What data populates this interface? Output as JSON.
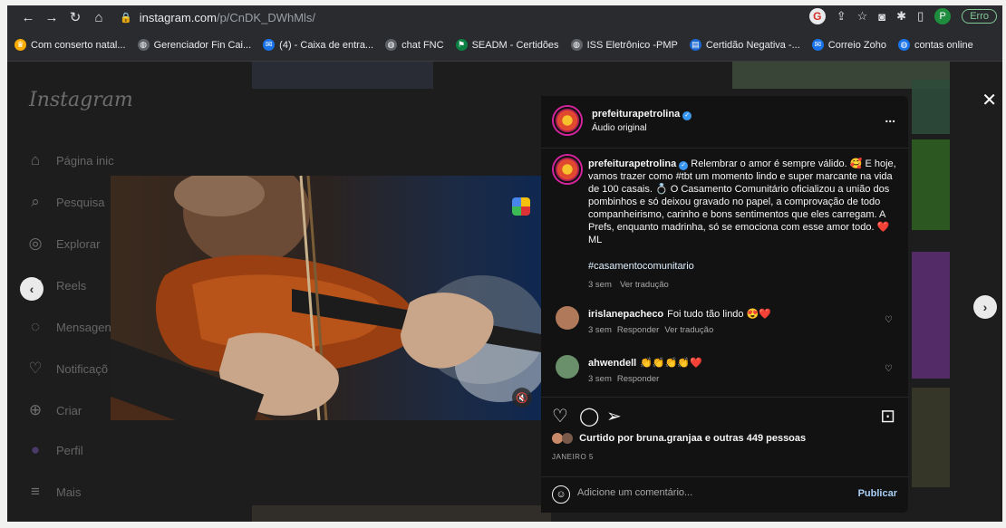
{
  "browser": {
    "url_host": "instagram.com",
    "url_path": "/p/CnDK_DWhMls/",
    "error_button": "Erro",
    "profile_initial": "P"
  },
  "bookmarks": [
    {
      "label": "Com conserto natal...",
      "icon": "crown-icon",
      "color": "#f9ab00"
    },
    {
      "label": "Gerenciador Fin Cai...",
      "icon": "globe-icon",
      "color": "#5f6368"
    },
    {
      "label": "(4) - Caixa de entra...",
      "icon": "mail-icon",
      "color": "#1a73e8"
    },
    {
      "label": "chat FNC",
      "icon": "globe-icon",
      "color": "#5f6368"
    },
    {
      "label": "SEADM - Certidões",
      "icon": "flag-icon",
      "color": "#0b8043"
    },
    {
      "label": "ISS Eletrônico -PMP",
      "icon": "globe-icon",
      "color": "#5f6368"
    },
    {
      "label": "Certidão Negativa -...",
      "icon": "document-icon",
      "color": "#1967d2"
    },
    {
      "label": "Correio Zoho",
      "icon": "mail-icon",
      "color": "#1a73e8"
    },
    {
      "label": "contas online",
      "icon": "globe-icon",
      "color": "#1a73e8"
    }
  ],
  "sidebar": {
    "logo": "Instagram",
    "items": [
      {
        "label": "Página inic",
        "icon": "home-icon"
      },
      {
        "label": "Pesquisa",
        "icon": "search-icon"
      },
      {
        "label": "Explorar",
        "icon": "compass-icon"
      },
      {
        "label": "Reels",
        "icon": "reels-icon"
      },
      {
        "label": "Mensagen",
        "icon": "messenger-icon"
      },
      {
        "label": "Notificaçõ",
        "icon": "heart-icon"
      },
      {
        "label": "Criar",
        "icon": "plus-icon"
      },
      {
        "label": "Perfil",
        "icon": "avatar-icon"
      },
      {
        "label": "Mais",
        "icon": "menu-icon"
      }
    ]
  },
  "post": {
    "username": "prefeiturapetrolina",
    "audio": "Áudio original",
    "more": "...",
    "caption": "Relembrar o amor é sempre válido. 🥰 E hoje, vamos trazer como #tbt um momento lindo e super marcante na vida de 100 casais. 💍 O Casamento Comunitário oficializou a união dos pombinhos e só deixou gravado no papel, a comprovação de todo companheirismo, carinho e bons sentimentos que eles carregam. A Prefs, enquanto madrinha, só se emociona com esse amor todo. ❤️ML",
    "hashtag": "#casamentocomunitario",
    "caption_time": "3 sem",
    "see_translation": "Ver tradução",
    "comments": [
      {
        "username": "irislanepacheco",
        "text": "Foi tudo tão lindo 😍❤️",
        "time": "3 sem",
        "reply": "Responder",
        "translate": "Ver tradução",
        "avatar_color": "#b07a5a"
      },
      {
        "username": "ahwendell",
        "text": "👏👏👏👏❤️",
        "time": "3 sem",
        "reply": "Responder",
        "translate": "",
        "avatar_color": "#6a8f6b"
      }
    ],
    "likes": "Curtido por bruna.granjaa e outras 449 pessoas",
    "likes_user": "brunagranjaa",
    "date": "JANEIRO 5",
    "comment_placeholder": "Adicione um comentário...",
    "publish": "Publicar"
  }
}
